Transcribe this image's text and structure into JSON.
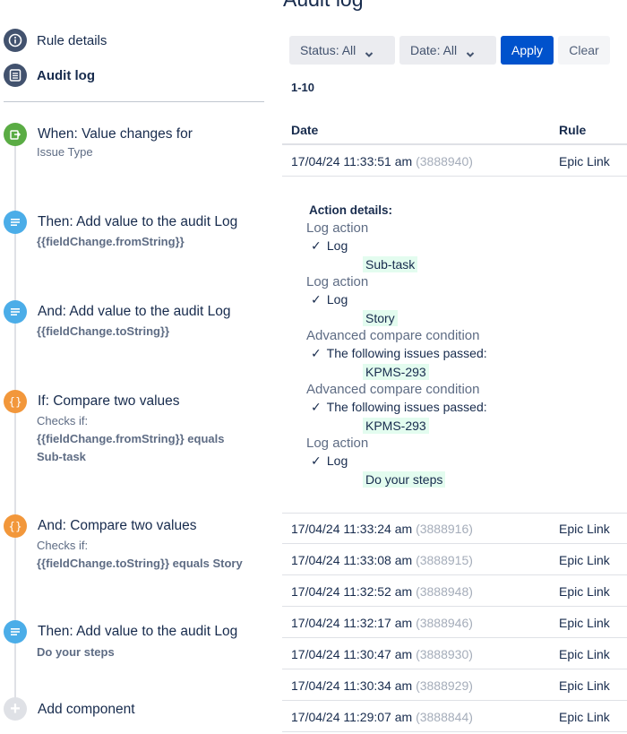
{
  "page": {
    "title": "Audit log"
  },
  "nav": {
    "rule_details": "Rule details",
    "audit_log": "Audit log"
  },
  "components": [
    {
      "title": "When: Value changes for",
      "lines": [
        "Issue Type"
      ],
      "color": "#5aac44",
      "icon": "trigger-icon"
    },
    {
      "title": "Then: Add value to the audit Log",
      "lines": [
        "{{fieldChange.fromString}}"
      ],
      "color": "#4bade8",
      "icon": "log-action-icon"
    },
    {
      "title": "And: Add value to the audit Log",
      "lines": [
        "{{fieldChange.toString}}"
      ],
      "color": "#4bade8",
      "icon": "log-action-icon"
    },
    {
      "title": "If: Compare two values",
      "lines": [
        "Checks if:",
        "{{fieldChange.fromString}} equals",
        "Sub-task"
      ],
      "color": "#f2973b",
      "icon": "condition-icon"
    },
    {
      "title": "And: Compare two values",
      "lines": [
        "Checks if:",
        "{{fieldChange.toString}} equals Story"
      ],
      "color": "#f2973b",
      "icon": "condition-icon"
    },
    {
      "title": "Then: Add value to the audit Log",
      "lines": [
        "Do your steps"
      ],
      "color": "#4bade8",
      "icon": "log-action-icon"
    }
  ],
  "add_component": {
    "label": "Add component",
    "glyph": "+"
  },
  "filters": {
    "status": "Status: All",
    "date": "Date: All",
    "apply": "Apply",
    "clear": "Clear"
  },
  "range": "1-10",
  "table": {
    "headers": {
      "date": "Date",
      "rule": "Rule"
    },
    "first_row": {
      "date": "17/04/24 11:33:51 am",
      "id": "(3888940)",
      "rule": "Epic Link"
    },
    "rows": [
      {
        "date": "17/04/24 11:33:24 am",
        "id": "(3888916)",
        "rule": "Epic Link"
      },
      {
        "date": "17/04/24 11:33:08 am",
        "id": "(3888915)",
        "rule": "Epic Link"
      },
      {
        "date": "17/04/24 11:32:52 am",
        "id": "(3888948)",
        "rule": "Epic Link"
      },
      {
        "date": "17/04/24 11:32:17 am",
        "id": "(3888946)",
        "rule": "Epic Link"
      },
      {
        "date": "17/04/24 11:30:47 am",
        "id": "(3888930)",
        "rule": "Epic Link"
      },
      {
        "date": "17/04/24 11:30:34 am",
        "id": "(3888929)",
        "rule": "Epic Link"
      },
      {
        "date": "17/04/24 11:29:07 am",
        "id": "(3888844)",
        "rule": "Epic Link"
      }
    ]
  },
  "details": {
    "heading": "Action details:",
    "check_glyph": "✓",
    "items": [
      {
        "type": "Log action",
        "check": "Log",
        "value": "Sub-task"
      },
      {
        "type": "Log action",
        "check": "Log",
        "value": "Story"
      },
      {
        "type": "Advanced compare condition",
        "check": "The following issues passed:",
        "value": "KPMS-293"
      },
      {
        "type": "Advanced compare condition",
        "check": "The following issues passed:",
        "value": "KPMS-293"
      },
      {
        "type": "Log action",
        "check": "Log",
        "value": "Do your steps"
      }
    ]
  }
}
